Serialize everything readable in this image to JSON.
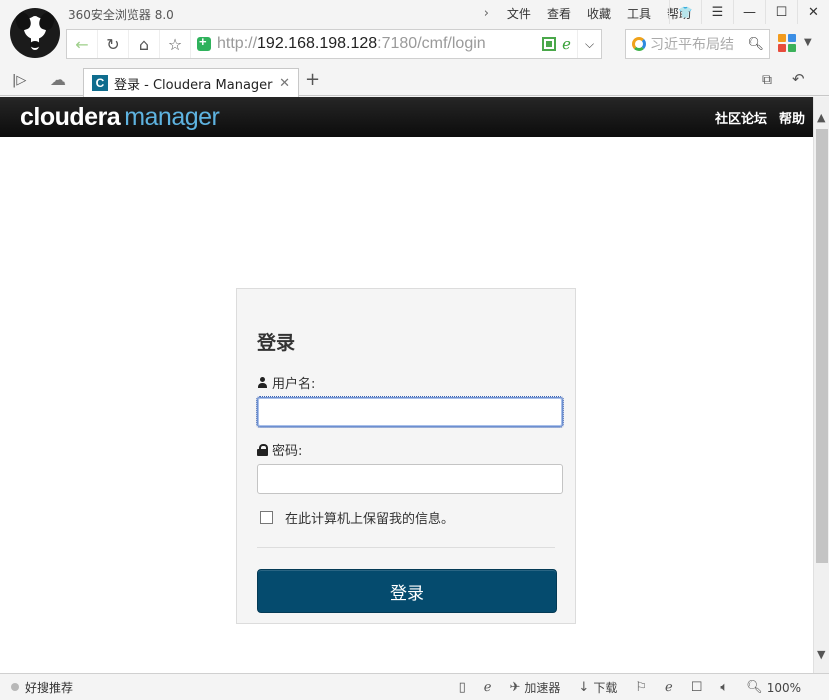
{
  "window": {
    "title": "360安全浏览器 8.0",
    "menu": [
      "文件",
      "查看",
      "收藏",
      "工具",
      "帮助"
    ],
    "address_prefix": "http://",
    "address_host": "192.168.198.128",
    "address_suffix": ":7180/cmf/login",
    "search_placeholder": "习近平布局结",
    "tab_title": "登录 - Cloudera Manager",
    "favicon_letter": "C"
  },
  "page": {
    "logo_primary": "cloudera",
    "logo_secondary": "manager",
    "header_links": [
      "社区论坛",
      "帮助"
    ],
    "login": {
      "title": "登录",
      "username_label": "用户名:",
      "username_value": "",
      "password_label": "密码:",
      "password_value": "",
      "remember_label": "在此计算机上保留我的信息。",
      "remember_checked": false,
      "submit_label": "登录"
    }
  },
  "statusbar": {
    "left_text": "好搜推荐",
    "accelerator": "加速器",
    "download": "下载",
    "zoom": "100%"
  },
  "colors": {
    "login_button": "#054b6e",
    "logo_secondary": "#5eb3e0",
    "header_bg": "#111111"
  }
}
